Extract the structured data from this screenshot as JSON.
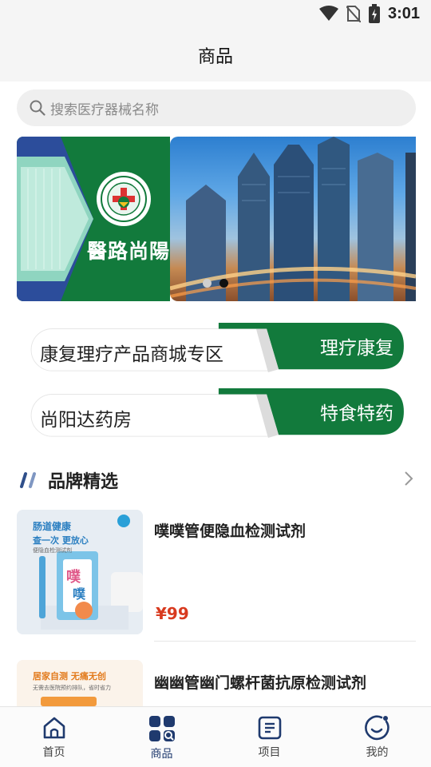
{
  "status_bar": {
    "time": "3:01"
  },
  "header": {
    "title": "商品"
  },
  "search": {
    "placeholder": "搜索医疗器械名称"
  },
  "banner": {
    "logo_text": "醫路尚陽",
    "seal_text": "SUNSHINE HEALTH GUARD",
    "slide_count": 2,
    "active_slide": 2
  },
  "promos": [
    {
      "left_label": "康复理疗产品商城专区",
      "right_label": "理疗康复"
    },
    {
      "left_label": "尚阳达药房",
      "right_label": "特食特药"
    }
  ],
  "section": {
    "title": "品牌精选"
  },
  "products": [
    {
      "name": "噗噗管便隐血检测试剂",
      "price": "¥99",
      "image_texts": [
        "肠道健康",
        "查一次 更放心",
        "便隐血检测试剂",
        "噗",
        "噗"
      ]
    },
    {
      "name": "幽幽管幽门螺杆菌抗原检测试剂",
      "image_texts": [
        "居家自测 无痛无创",
        "无需去医院预约排队，省时省力"
      ]
    }
  ],
  "tabbar": {
    "items": [
      {
        "label": "首页",
        "icon": "home-icon",
        "active": false
      },
      {
        "label": "商品",
        "icon": "products-grid-icon",
        "active": true
      },
      {
        "label": "项目",
        "icon": "document-icon",
        "active": false
      },
      {
        "label": "我的",
        "icon": "profile-icon",
        "active": false
      }
    ]
  },
  "colors": {
    "brand_green": "#127a3c",
    "price_red": "#d83a1f",
    "tab_active": "#1f3a6e",
    "accent_blue": "#2f4f8a"
  }
}
